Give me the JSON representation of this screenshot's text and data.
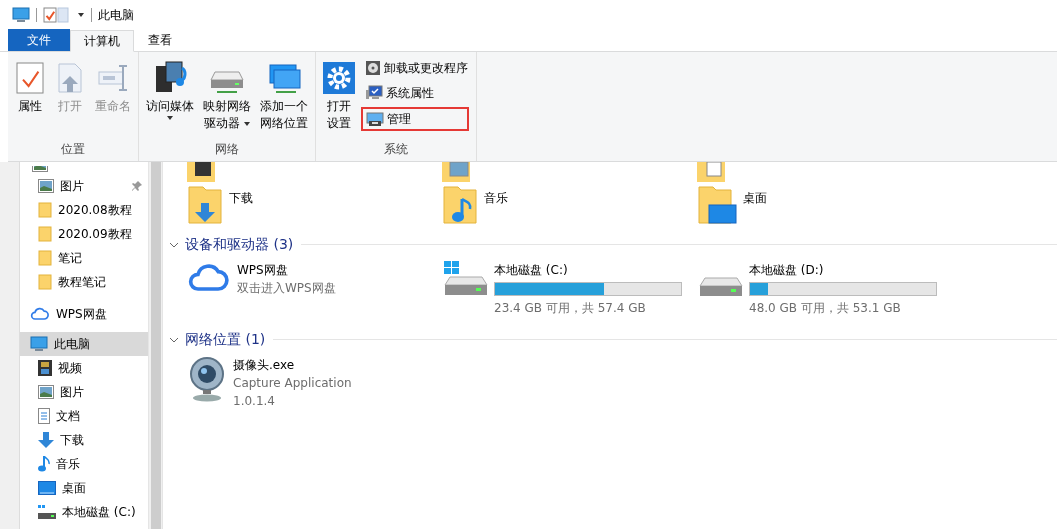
{
  "titlebar": {
    "title": "此电脑"
  },
  "ribbon_tabs": [
    {
      "label": "文件",
      "kind": "file",
      "selected": false
    },
    {
      "label": "计算机",
      "kind": "tab",
      "selected": true
    },
    {
      "label": "查看",
      "kind": "tab",
      "selected": false
    }
  ],
  "ribbon_groups": [
    {
      "label": "位置",
      "large_buttons": [
        {
          "lines": [
            "属性"
          ],
          "disabled": false,
          "dropdown": false
        },
        {
          "lines": [
            "打开"
          ],
          "disabled": true,
          "dropdown": false
        },
        {
          "lines": [
            "重命名"
          ],
          "disabled": true,
          "dropdown": false
        }
      ]
    },
    {
      "label": "网络",
      "large_buttons": [
        {
          "lines": [
            "访问媒体"
          ],
          "disabled": false,
          "dropdown": true
        },
        {
          "lines": [
            "映射网络",
            "驱动器"
          ],
          "disabled": false,
          "dropdown": true
        },
        {
          "lines": [
            "添加一个",
            "网络位置"
          ],
          "disabled": false,
          "dropdown": false
        }
      ]
    },
    {
      "label": "系统",
      "large_buttons": [
        {
          "lines": [
            "打开",
            "设置"
          ],
          "disabled": false,
          "dropdown": false
        }
      ],
      "small_buttons": [
        {
          "label": "卸载或更改程序",
          "highlighted": false
        },
        {
          "label": "系统属性",
          "highlighted": false
        },
        {
          "label": "管理",
          "highlighted": true
        }
      ]
    }
  ],
  "quick_access": [
    {
      "label": "图片",
      "pinned": true
    },
    {
      "label": "2020.08教程",
      "pinned": false
    },
    {
      "label": "2020.09教程",
      "pinned": false
    },
    {
      "label": "笔记",
      "pinned": false
    },
    {
      "label": "教程笔记",
      "pinned": false
    }
  ],
  "nav_tree": [
    {
      "label": "WPS网盘",
      "selected": false
    },
    {
      "label": "此电脑",
      "selected": true,
      "children": [
        {
          "label": "视频"
        },
        {
          "label": "图片"
        },
        {
          "label": "文档"
        },
        {
          "label": "下载"
        },
        {
          "label": "音乐"
        },
        {
          "label": "桌面"
        },
        {
          "label": "本地磁盘 (C:)"
        }
      ]
    }
  ],
  "folders": [
    {
      "name": "下载"
    },
    {
      "name": "音乐"
    },
    {
      "name": "桌面"
    }
  ],
  "sections": [
    {
      "title": "设备和驱动器 (3)",
      "expanded": true,
      "items": [
        {
          "kind": "cloud",
          "name": "WPS网盘",
          "subtitle": "双击进入WPS网盘"
        },
        {
          "kind": "drive",
          "name": "本地磁盘 (C:)",
          "level": 0.585,
          "reading": "23.4 GB 可用，共 57.4 GB",
          "system": true
        },
        {
          "kind": "drive",
          "name": "本地磁盘 (D:)",
          "level": 0.096,
          "reading": "48.0 GB 可用，共 53.1 GB",
          "system": false
        }
      ]
    },
    {
      "title": "网络位置 (1)",
      "expanded": true,
      "items": [
        {
          "kind": "app",
          "name": "摄像头.exe",
          "subtitle": "Capture Application",
          "version": "1.0.1.4"
        }
      ]
    }
  ]
}
